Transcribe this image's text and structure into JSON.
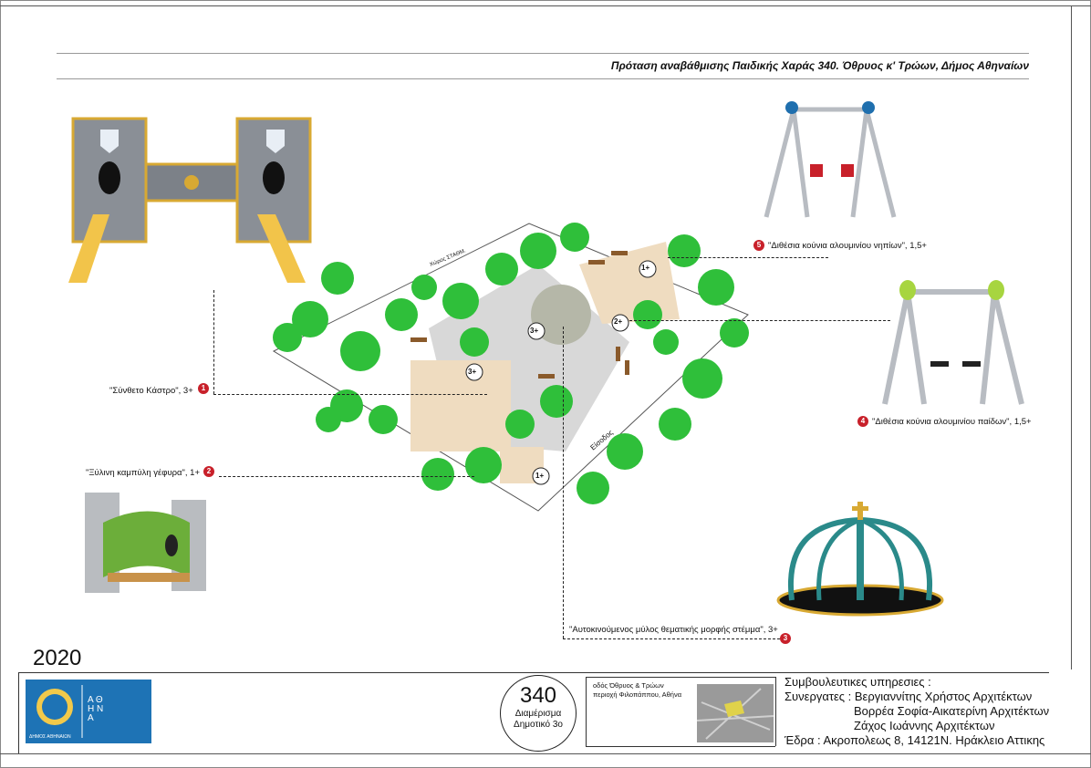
{
  "header": {
    "title": "Πρόταση αναβάθμισης Παιδικής Χαράς 340. Όθρυος κ' Τρώων, Δήμος Αθηναίων"
  },
  "plan": {
    "street_top": "Χώρος ΣΤΑΘΜ.",
    "entrance": "Είσοδος",
    "ages": [
      "3+",
      "3+",
      "1+",
      "2+",
      "1+"
    ]
  },
  "callouts": [
    {
      "num": "1",
      "text": "\"Σύνθετο Κάστρο\", 3+"
    },
    {
      "num": "2",
      "text": "\"Ξύλινη καμπύλη γέφυρα\", 1+"
    },
    {
      "num": "3",
      "text": "\"Αυτοκινούμενος μύλος θεματικής μορφής στέμμα\", 3+"
    },
    {
      "num": "4",
      "text": "\"Διθέσια κούνια αλουμινίου παίδων\", 1,5+"
    },
    {
      "num": "5",
      "text": "\"Διθέσια κούνια αλουμινίου νηπίων\", 1,5+"
    }
  ],
  "footer": {
    "year": "2020",
    "logo_caption_left": "ΔΗΜΟΣ ΑΘΗΝΑΙΩΝ",
    "logo_letters": "Α Θ Η Ν Α",
    "code": "340",
    "code_line1": "Διαμέρισμα",
    "code_line2": "Δημοτικό 3ο",
    "address_line1": "οδός Όθρυος & Τρώων",
    "address_line2": "περιοχή Φιλοπάππου, Αθήνα",
    "credits_heading": "Συμβουλευτικες υπηρεσιες :",
    "credits_line1": "Συνεργατες : Βεργιαννίτης Χρήστος Αρχιτέκτων",
    "credits_line2": "Βορρέα Σοφία-Αικατερίνη Αρχιτέκτων",
    "credits_line3": "Ζάχος Ιωάννης Αρχιτέκτων",
    "credits_line4": "Έδρα : Ακροπολεως 8, 14121Ν. Ηράκλειο Αττικης"
  },
  "colors": {
    "tree": "#2fbf3a",
    "callout": "#c8202a",
    "castle": "#8a8f96",
    "slide": "#f2c44a",
    "bridge_green": "#6cae3a",
    "carousel": "#2a8a8a",
    "sand": "#efdcc0",
    "paving": "#d8d8d8"
  }
}
